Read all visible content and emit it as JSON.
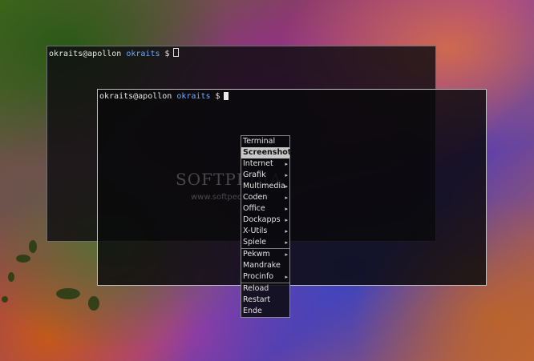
{
  "terminals": [
    {
      "user_host": "okraits@apollon",
      "dir": "okraits",
      "symbol": "$"
    },
    {
      "user_host": "okraits@apollon",
      "dir": "okraits",
      "symbol": "$"
    }
  ],
  "menu": {
    "items_group1": [
      {
        "label": "Terminal",
        "submenu": ""
      },
      {
        "label": "Screenshot",
        "submenu": ""
      },
      {
        "label": "Internet",
        "submenu": "▸"
      },
      {
        "label": "Grafik",
        "submenu": "▸"
      },
      {
        "label": "Multimedia",
        "submenu": "▸"
      },
      {
        "label": "Coden",
        "submenu": "▸"
      },
      {
        "label": "Office",
        "submenu": "▸"
      },
      {
        "label": "Dockapps",
        "submenu": "▸"
      },
      {
        "label": "X-Utils",
        "submenu": "▸"
      },
      {
        "label": "Spiele",
        "submenu": "▸"
      }
    ],
    "items_group2": [
      {
        "label": "Pekwm",
        "submenu": "▸"
      },
      {
        "label": "Mandrake",
        "submenu": ""
      },
      {
        "label": "Procinfo",
        "submenu": "▸"
      }
    ],
    "items_group3": [
      {
        "label": "Reload",
        "submenu": ""
      },
      {
        "label": "Restart",
        "submenu": ""
      },
      {
        "label": "Ende",
        "submenu": ""
      }
    ],
    "selected": "Screenshot"
  },
  "watermark": {
    "text": "SOFTPEDIA",
    "tm": "™",
    "url": "www.softpedia.com"
  },
  "colors": {
    "prompt_dir": "#6fa8ff",
    "menu_highlight": "#c8c8c8"
  }
}
